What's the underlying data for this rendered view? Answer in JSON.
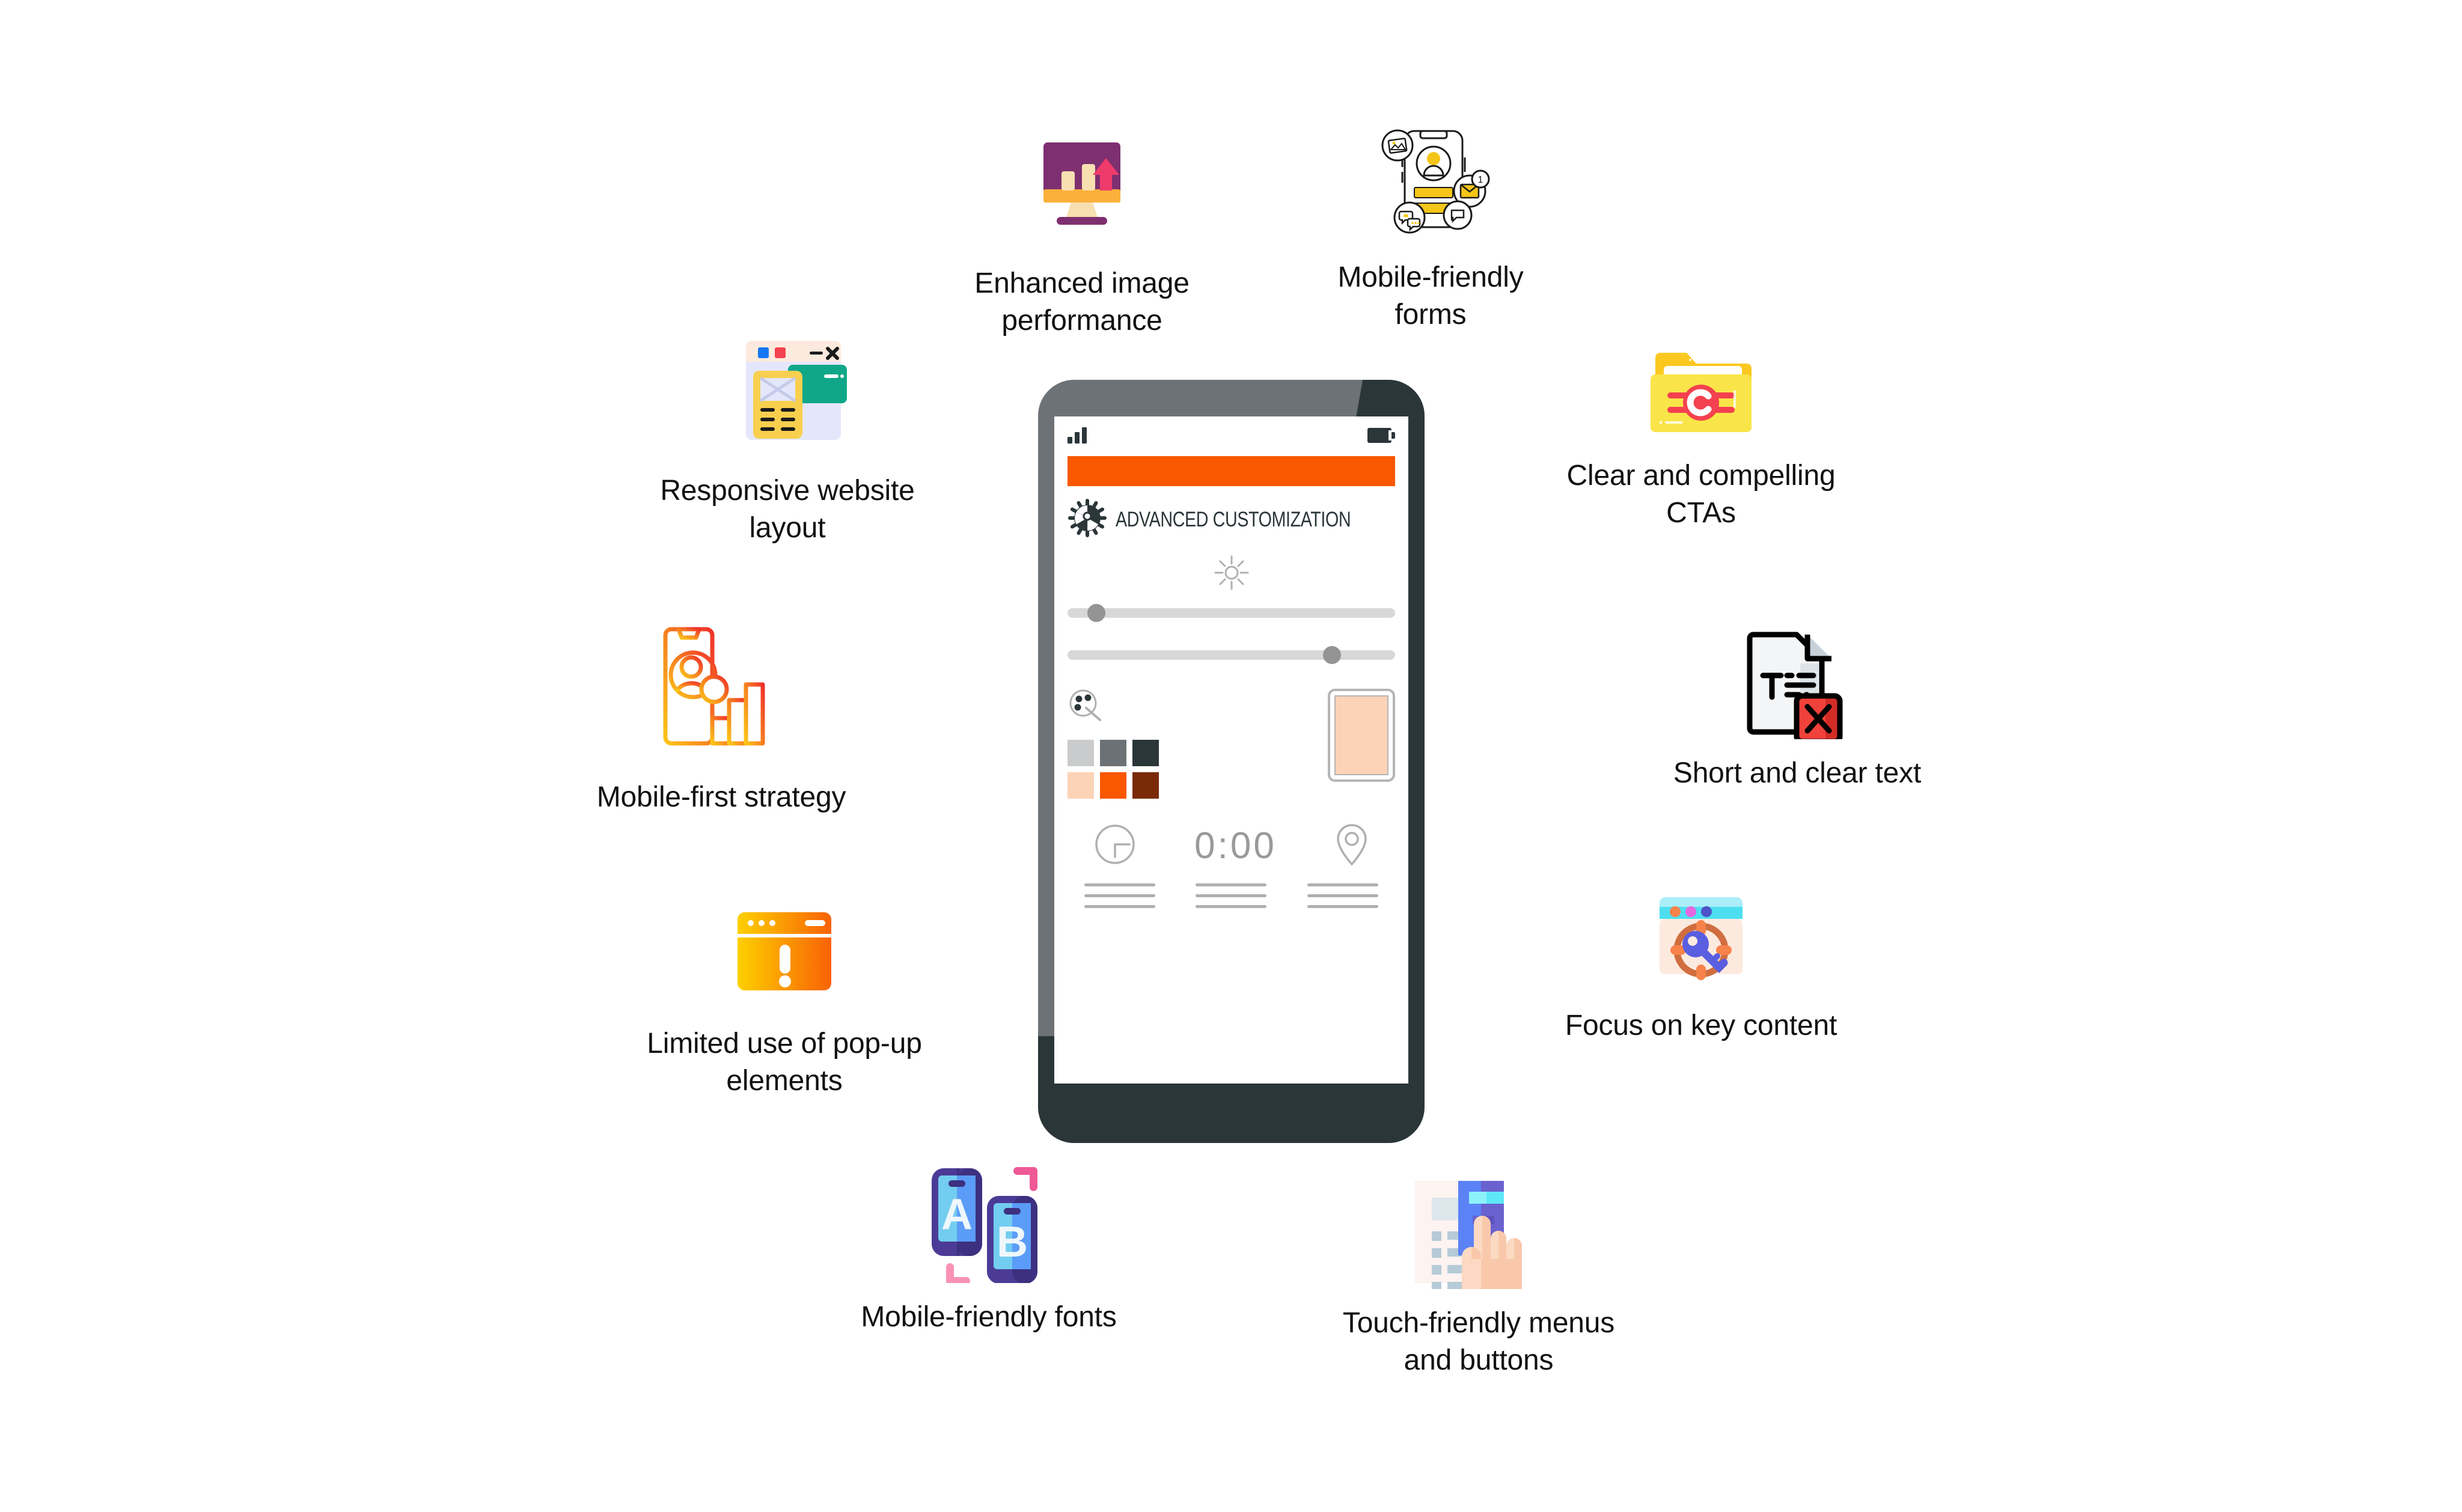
{
  "page": {
    "background": "#ffffff",
    "text_color": "#111111"
  },
  "features": [
    {
      "id": "enhanced-image-performance",
      "icon": "monitor-bar-chart-arrow-icon",
      "label": "Enhanced image\nperformance"
    },
    {
      "id": "mobile-friendly-forms",
      "icon": "phone-form-fields-icon",
      "label": "Mobile-friendly\nforms"
    },
    {
      "id": "responsive-website-layout",
      "icon": "browser-window-cards-icon",
      "label": "Responsive website\nlayout"
    },
    {
      "id": "clear-and-compelling-ctas",
      "icon": "folder-cta-icon",
      "label": "Clear and compelling\nCTAs"
    },
    {
      "id": "mobile-first-strategy",
      "icon": "phone-user-chart-icon",
      "label": "Mobile-first strategy"
    },
    {
      "id": "short-and-clear-text",
      "icon": "document-text-x-icon",
      "label": "Short and clear text"
    },
    {
      "id": "limited-use-of-popup-elements",
      "icon": "popup-alert-window-icon",
      "label": "Limited use of pop-up\nelements"
    },
    {
      "id": "focus-on-key-content",
      "icon": "browser-target-key-icon",
      "label": "Focus on key content"
    },
    {
      "id": "mobile-friendly-fonts",
      "icon": "two-phones-ab-icon",
      "label": "Mobile-friendly fonts"
    },
    {
      "id": "touch-friendly-menus-and-buttons",
      "icon": "hand-tap-menu-icon",
      "label": "Touch-friendly menus\nand buttons"
    }
  ],
  "phone": {
    "statusbar": {
      "signal_icon": "signal-bars-icon",
      "battery_icon": "battery-icon"
    },
    "app": {
      "logo_icon": "gear-icon",
      "title": "ADVANCED CUSTOMIZATION",
      "accent_color": "#f95700"
    },
    "brightness": {
      "icon": "sun-brightness-icon"
    },
    "sliders": [
      {
        "name": "slider-one",
        "value_pct": 6
      },
      {
        "name": "slider-two",
        "value_pct": 78
      }
    ],
    "palette": {
      "icon": "color-palette-icon",
      "swatches": [
        "#c9cbcc",
        "#6b7174",
        "#2b3639",
        "#fcd3b6",
        "#f95700",
        "#7a2a07"
      ],
      "preview_color": "#fcd3b6"
    },
    "widgets": [
      {
        "name": "clock-widget",
        "icon": "clock-icon"
      },
      {
        "name": "timer-widget",
        "value": "0:00"
      },
      {
        "name": "location-widget",
        "icon": "map-pin-icon"
      }
    ]
  }
}
